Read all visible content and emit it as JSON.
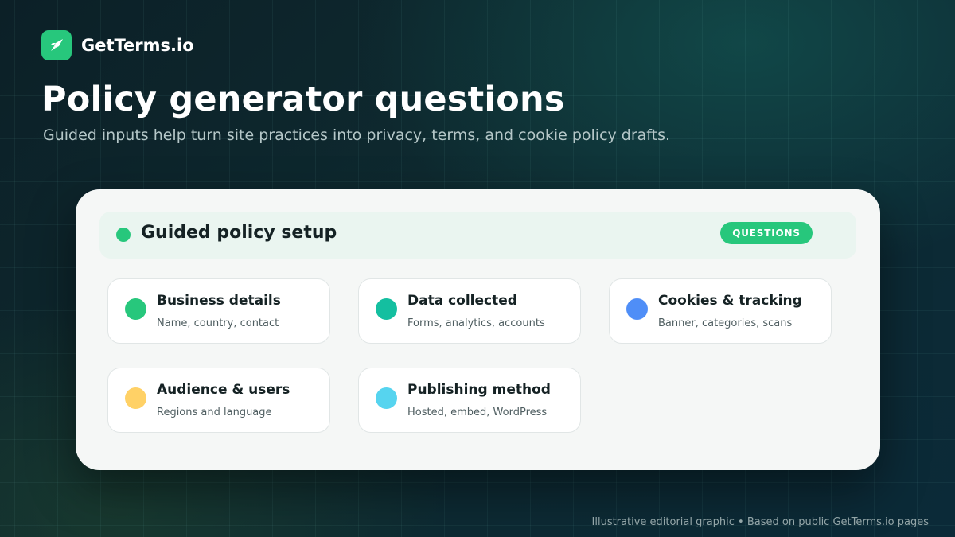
{
  "brand": {
    "name": "GetTerms.io",
    "logo_icon": "rocket-icon",
    "logo_color": "#27c77c"
  },
  "hero": {
    "title": "Policy generator questions",
    "subtitle": "Guided inputs help turn site practices into privacy, terms, and cookie policy drafts."
  },
  "panel": {
    "title": "Guided policy setup",
    "badge": "QUESTIONS",
    "accent_color": "#27c77c",
    "items": [
      {
        "title": "Business details",
        "subtitle": "Name, country, contact",
        "dot_color": "#27c77c"
      },
      {
        "title": "Data collected",
        "subtitle": "Forms, analytics, accounts",
        "dot_color": "#14bfa0"
      },
      {
        "title": "Cookies & tracking",
        "subtitle": "Banner, categories, scans",
        "dot_color": "#4f8ef7"
      },
      {
        "title": "Audience & users",
        "subtitle": "Regions and language",
        "dot_color": "#ffd166"
      },
      {
        "title": "Publishing method",
        "subtitle": "Hosted, embed, WordPress",
        "dot_color": "#56d4ef"
      }
    ]
  },
  "footer": {
    "note": "Illustrative editorial graphic • Based on public GetTerms.io pages"
  }
}
